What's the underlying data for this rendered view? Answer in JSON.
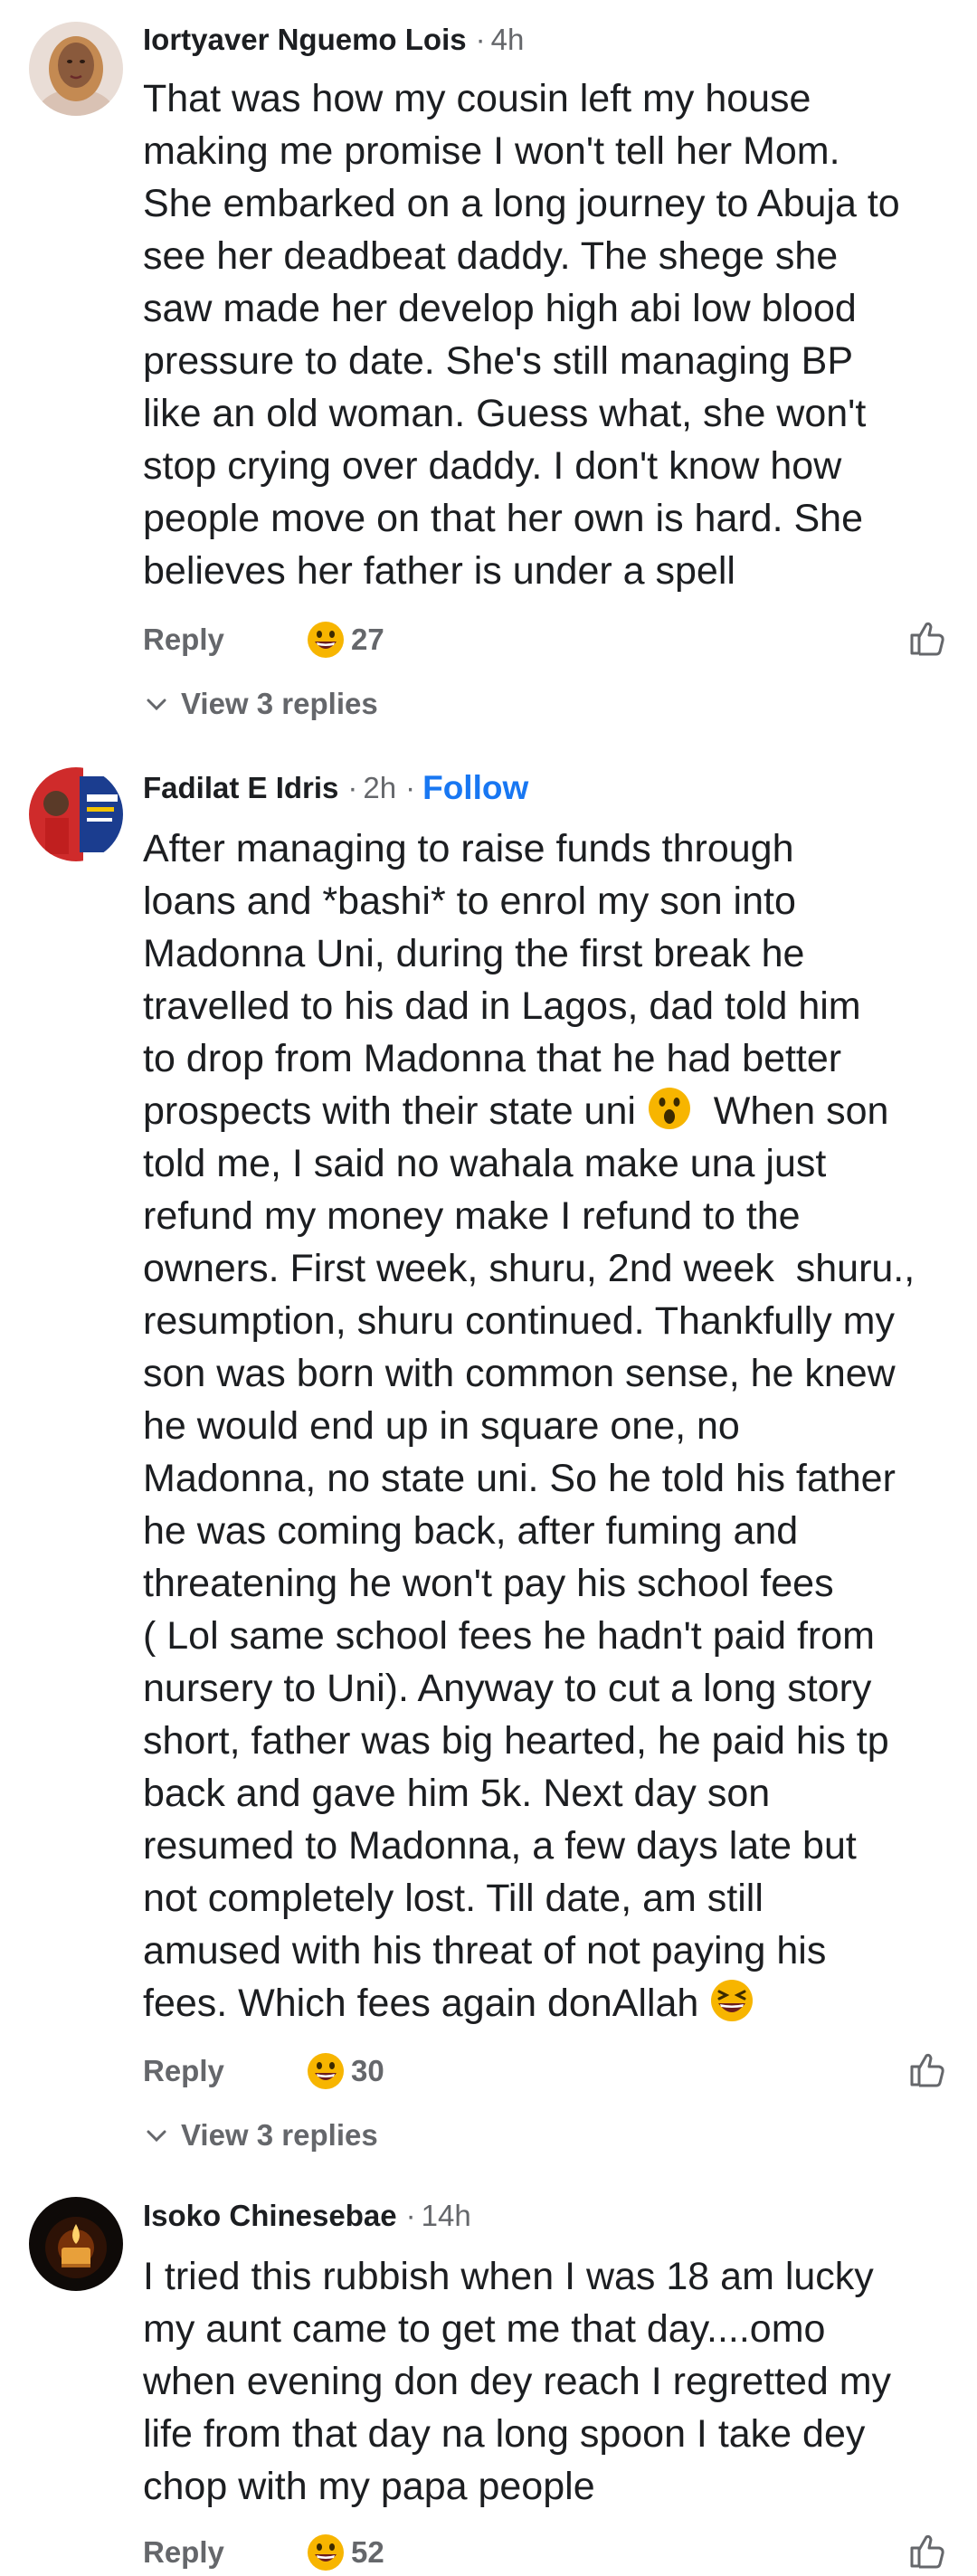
{
  "comments": [
    {
      "author": "Iortyaver Nguemo Lois",
      "time": "4h",
      "follow": "",
      "lines": [
        "That was how my cousin left my house",
        "making me promise I won't tell her Mom.",
        "She embarked on a long journey to Abuja to",
        "see her deadbeat daddy. The shege she",
        "saw made her develop high abi low blood",
        "pressure to date. She's still managing BP",
        "like an old woman. Guess what, she won't",
        "stop crying over daddy. I don't know how",
        "people move on that her own is hard. She",
        "believes her father is under a spell"
      ],
      "reply_label": "Reply",
      "reaction_icon": "grinning-sweat-emoji",
      "reaction_count": "27",
      "view_replies": "View 3 replies"
    },
    {
      "author": "Fadilat E Idris",
      "time": "2h",
      "follow": "Follow",
      "lines": [
        "After managing to raise funds through",
        "loans and *bashi* to enrol my son into",
        "Madonna Uni, during the first break he",
        "travelled to his dad in Lagos, dad told him",
        "to drop from Madonna that he had better",
        "prospects with their state uni",
        "told me, I said no wahala make una just",
        "refund my money make I refund to the",
        "owners. First week, shuru, 2nd week  shuru.,",
        "resumption, shuru continued. Thankfully my",
        "son was born with common sense, he knew",
        "he would end up in square one, no",
        "Madonna, no state uni. So he told his father",
        "he was coming back, after fuming and",
        "threatening he won't pay his school fees",
        "( Lol same school fees he hadn't paid from",
        "nursery to Uni). Anyway to cut a long story",
        "short, father was big hearted, he paid his tp",
        "back and gave him 5k. Next day son",
        "resumed to Madonna, a few days late but",
        "not completely lost. Till date, am still",
        "amused with his threat of not paying his",
        "fees. Which fees again donAllah"
      ],
      "line6_tail": "When son",
      "reply_label": "Reply",
      "reaction_icon": "grinning-sweat-emoji",
      "reaction_count": "30",
      "view_replies": "View 3 replies"
    },
    {
      "author": "Isoko Chinesebae",
      "time": "14h",
      "follow": "",
      "lines": [
        "I tried this rubbish when I was 18 am lucky",
        "my aunt came to get me that day....omo",
        "when evening don dey reach I regretted my",
        "life from that day na long spoon I take dey",
        "chop with my papa people"
      ],
      "reply_label": "Reply",
      "reaction_icon": "grinning-sweat-emoji",
      "reaction_count": "52",
      "view_replies": ""
    }
  ],
  "colors": {
    "text": "#1c1e21",
    "muted": "#65676b",
    "link": "#1877f2",
    "background": "#ffffff"
  },
  "icons": {
    "like": "thumbs-up-outline-icon",
    "expand": "chevron-down-icon",
    "surprised": "hushed-face-emoji",
    "laughing": "squinting-laughing-emoji"
  }
}
